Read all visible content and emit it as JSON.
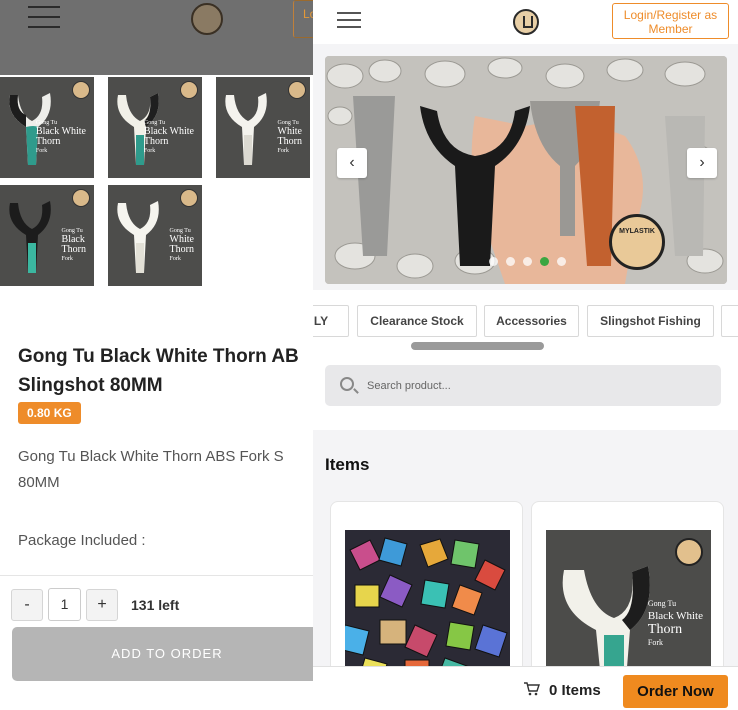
{
  "left": {
    "header": {
      "login_label": "Lo"
    },
    "thumbnails": [
      {
        "caption_line1": "Gong Tu",
        "caption_line2": "Black White",
        "caption_line3": "Thorn",
        "caption_line4": "Fork"
      },
      {
        "caption_line1": "Gong Tu",
        "caption_line2": "Black White",
        "caption_line3": "Thorn",
        "caption_line4": "Fork"
      },
      {
        "caption_line1": "Gong Tu",
        "caption_line2": "White",
        "caption_line3": "Thorn",
        "caption_line4": "Fork"
      },
      {
        "caption_line1": "Gong Tu",
        "caption_line2": "Black",
        "caption_line3": "Thorn",
        "caption_line4": "Fork"
      },
      {
        "caption_line1": "Gong Tu",
        "caption_line2": "White",
        "caption_line3": "Thorn",
        "caption_line4": "Fork"
      }
    ],
    "product": {
      "title_line1": "Gong Tu Black White Thorn AB",
      "title_line2": "Slingshot 80MM",
      "weight": "0.80 KG",
      "description_line1": "Gong Tu Black White Thorn ABS Fork S",
      "description_line2": "80MM",
      "package_label": "Package Included :"
    },
    "quantity": {
      "minus": "-",
      "value": "1",
      "plus": "+",
      "stock": "131 left",
      "add_to_order": "ADD TO ORDER"
    }
  },
  "right": {
    "header": {
      "login_label": "Login/Register as Member"
    },
    "hero": {
      "prev_arrow": "‹",
      "next_arrow": "›",
      "seal_text": "MYLASTIK",
      "slide_count": 5,
      "active_slide": 4
    },
    "categories": [
      {
        "label": "LY"
      },
      {
        "label": "Clearance Stock"
      },
      {
        "label": "Accessories"
      },
      {
        "label": "Slingshot Fishing"
      }
    ],
    "search": {
      "placeholder": "Search product..."
    },
    "items_title": "Items",
    "product_cards": [
      {
        "caption": ""
      },
      {
        "caption_line1": "Gong Tu",
        "caption_line2": "Black White",
        "caption_line3": "Thorn",
        "caption_line4": "Fork"
      }
    ],
    "cart": {
      "count_label": "0 Items",
      "order_now": "Order Now"
    }
  },
  "colors": {
    "accent": "#ee8c2a",
    "order_button": "#ef8a1f",
    "active_dot": "#3aa641",
    "disabled_button": "#b5b5b5"
  }
}
